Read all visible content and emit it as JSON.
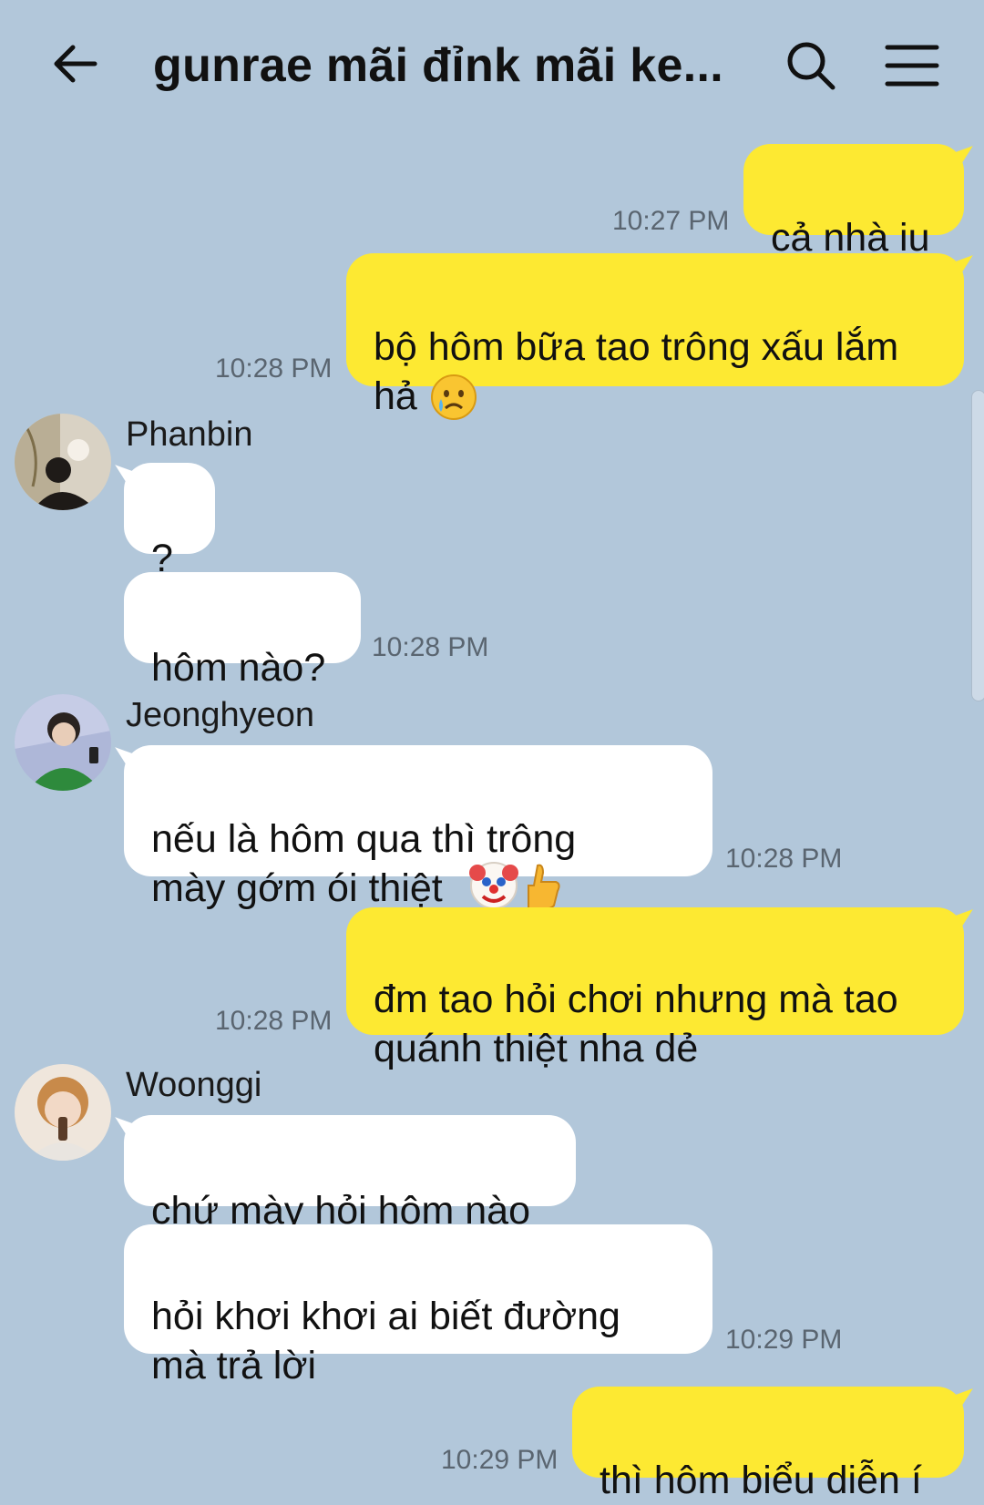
{
  "header": {
    "title": "gunrae mãi đỉnk mãi ke...",
    "back_icon": "arrow-left-icon",
    "search_icon": "search-icon",
    "menu_icon": "hamburger-menu-icon"
  },
  "colors": {
    "background": "#b2c7da",
    "my_bubble": "#fde932",
    "their_bubble": "#ffffff"
  },
  "messages": [
    {
      "from": "me",
      "text": "cả nhà iu",
      "time": "10:27 PM"
    },
    {
      "from": "me",
      "text": "bộ hôm bữa tao trông xấu lắm\nhả",
      "emoji": "crying-face-icon",
      "time": "10:28 PM"
    },
    {
      "from": "Phanbin",
      "text": "?"
    },
    {
      "from": "Phanbin",
      "text": "hôm nào?",
      "time": "10:28 PM"
    },
    {
      "from": "Jeonghyeon",
      "text": "nếu là hôm qua thì trông\nmày gớm ói thiệt",
      "emoji": "clown-face-thumbs-up-icon",
      "time": "10:28 PM"
    },
    {
      "from": "me",
      "text": "đm tao hỏi chơi nhưng mà tao\nquánh thiệt nha dẻ",
      "time": "10:28 PM"
    },
    {
      "from": "Woonggi",
      "text": "chứ mày hỏi hôm nào"
    },
    {
      "from": "Woonggi",
      "text": "hỏi khơi khơi ai biết đường\nmà trả lời",
      "time": "10:29 PM"
    },
    {
      "from": "me",
      "text": "thì hôm biểu diễn í",
      "time": "10:29 PM"
    }
  ],
  "senders": {
    "phanbin": "Phanbin",
    "jeonghyeon": "Jeonghyeon",
    "woonggi": "Woonggi"
  }
}
